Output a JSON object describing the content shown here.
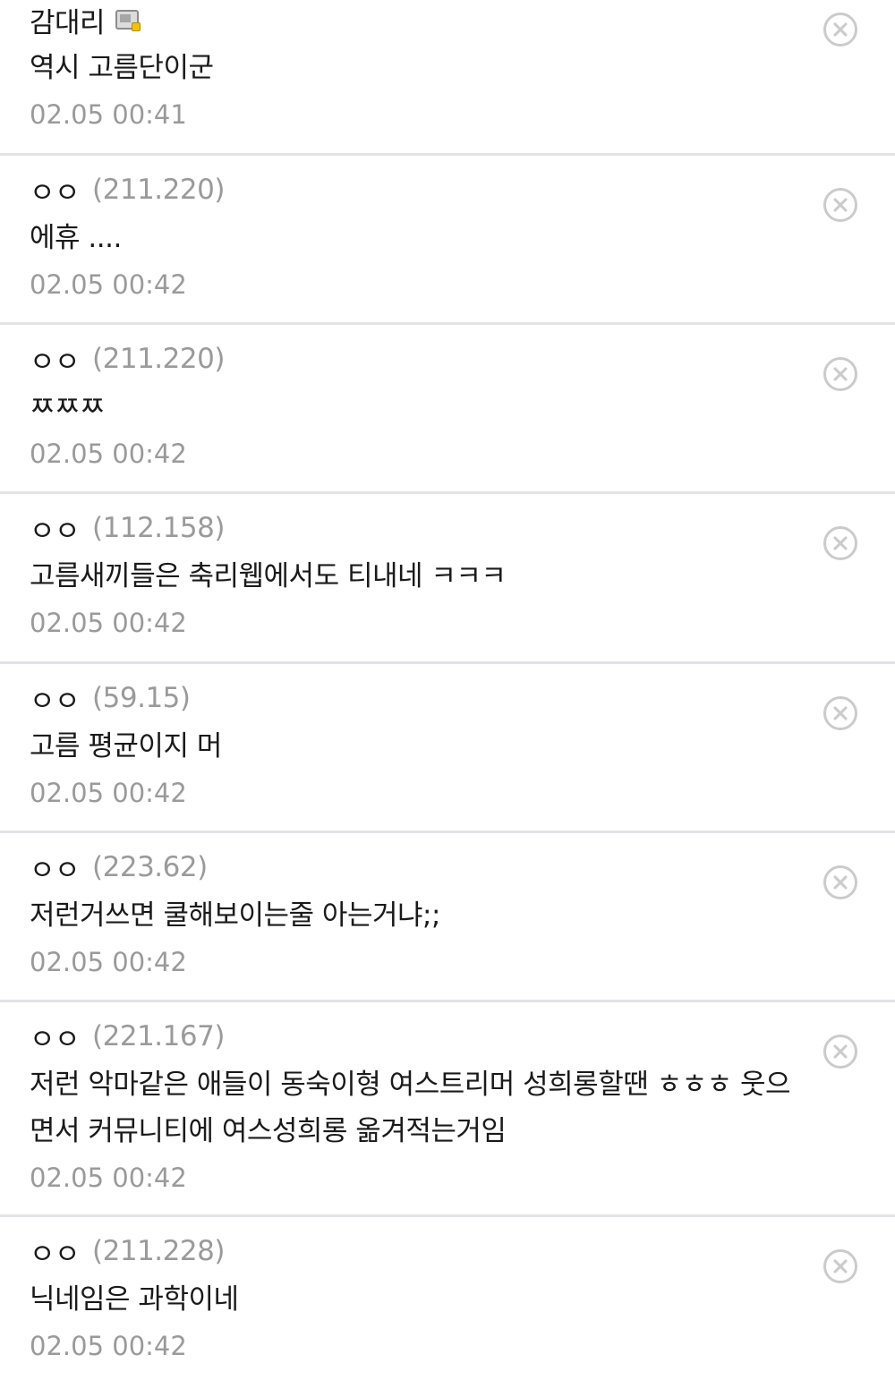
{
  "comments": [
    {
      "nick": "감대리",
      "ip": "",
      "text": "역시 고름단이군",
      "time": "02.05 00:41",
      "badge": "gallery-member-icon"
    },
    {
      "nick": "ㅇㅇ",
      "ip": "(211.220)",
      "text": "에휴 ....",
      "time": "02.05 00:42"
    },
    {
      "nick": "ㅇㅇ",
      "ip": "(211.220)",
      "text": "ㅉㅉㅉ",
      "time": "02.05 00:42"
    },
    {
      "nick": "ㅇㅇ",
      "ip": "(112.158)",
      "text": "고름새끼들은 축리웹에서도 티내네 ㅋㅋㅋ",
      "time": "02.05 00:42"
    },
    {
      "nick": "ㅇㅇ",
      "ip": "(59.15)",
      "text": "고름 평균이지 머",
      "time": "02.05 00:42"
    },
    {
      "nick": "ㅇㅇ",
      "ip": "(223.62)",
      "text": "저런거쓰면 쿨해보이는줄 아는거냐;;",
      "time": "02.05 00:42"
    },
    {
      "nick": "ㅇㅇ",
      "ip": "(221.167)",
      "text": "저런 악마같은 애들이 동숙이형 여스트리머 성희롱할땐 ㅎㅎㅎ 웃으면서 커뮤니티에 여스성희롱 옮겨적는거임",
      "time": "02.05 00:42"
    },
    {
      "nick": "ㅇㅇ",
      "ip": "(211.228)",
      "text": "닉네임은 과학이네",
      "time": "02.05 00:42"
    }
  ],
  "icons": {
    "delete": "close-circle-icon"
  },
  "colors": {
    "text": "#1a1a1a",
    "meta": "#9a9a9a",
    "divider": "#e2e2e8",
    "delete_icon": "#cbcbcb"
  }
}
